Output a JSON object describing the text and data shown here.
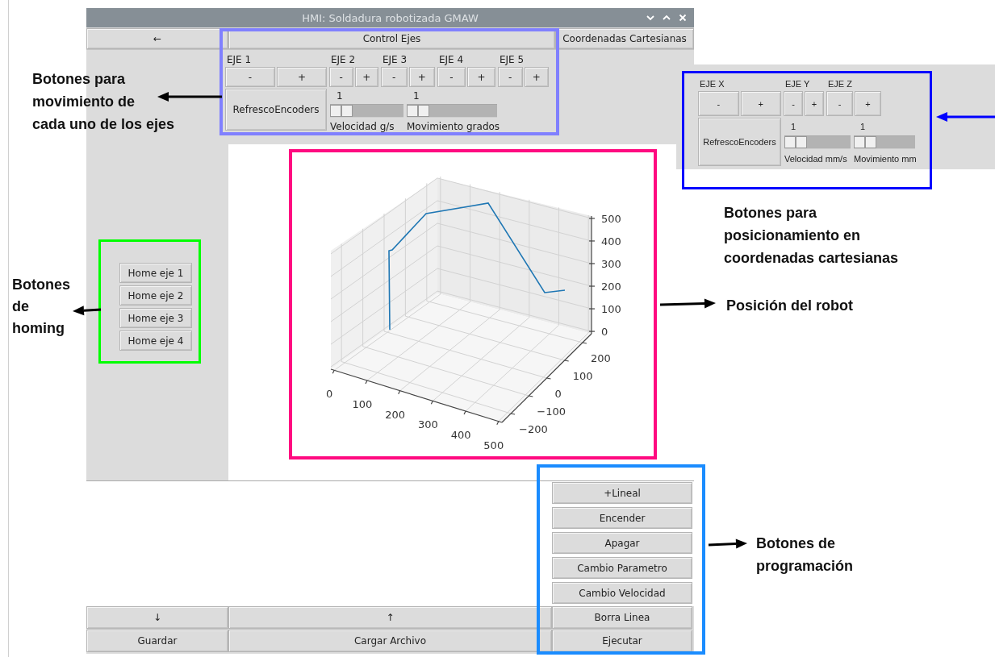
{
  "window": {
    "title": "HMI: Soldadura robotizada GMAW"
  },
  "top_buttons": [
    "←",
    "Control Ejes",
    "Coordenadas Cartesianas"
  ],
  "axis_panel": {
    "axes": [
      {
        "label": "EJE 1",
        "buttons": [
          "-",
          "+"
        ]
      },
      {
        "label": "EJE 2",
        "buttons": [
          "-",
          "+"
        ]
      },
      {
        "label": "EJE 3",
        "buttons": [
          "-",
          "+"
        ]
      },
      {
        "label": "EJE 4",
        "buttons": [
          "-",
          "+"
        ]
      },
      {
        "label": "EJE 5",
        "buttons": [
          "-",
          "+"
        ]
      }
    ],
    "refresh_button": "RefrescoEncoders",
    "sliders": [
      {
        "value": "1",
        "level": 0,
        "caption": "Velocidad g/s"
      },
      {
        "value": "1",
        "level": 0,
        "caption": "Movimiento grados"
      }
    ]
  },
  "homing_buttons": [
    "Home eje 1",
    "Home eje 2",
    "Home eje 3",
    "Home eje 4"
  ],
  "plot": {
    "x_ticks": [
      "0",
      "100",
      "200",
      "300",
      "400",
      "500"
    ],
    "y_ticks": [
      "−200",
      "−100",
      "0",
      "100",
      "200"
    ],
    "z_ticks": [
      "500",
      "400",
      "300",
      "200",
      "100",
      "0"
    ]
  },
  "program_buttons": [
    "+Lineal",
    "Encender",
    "Apagar",
    "Cambio Parametro",
    "Cambio Velocidad"
  ],
  "bottom_rows": [
    [
      "↓",
      "↑",
      "Borra Linea"
    ],
    [
      "Guardar",
      "Cargar Archivo",
      "Ejecutar"
    ]
  ],
  "cartesian_inset": {
    "axes": [
      {
        "label": "EJE X",
        "buttons": [
          "-",
          "+"
        ]
      },
      {
        "label": "EJE Y",
        "buttons": [
          "-",
          "+"
        ]
      },
      {
        "label": "EJE Z",
        "buttons": [
          "-",
          "+"
        ]
      }
    ],
    "refresh_button": "RefrescoEncoders",
    "sliders": [
      {
        "value": "1",
        "level": 0,
        "caption": "Velocidad mm/s"
      },
      {
        "value": "1",
        "level": 0,
        "caption": "Movimiento mm"
      }
    ]
  },
  "annotations": [
    {
      "lines": [
        "Botones para",
        "movimiento de",
        "cada uno de los ejes"
      ],
      "color": "#8080ff"
    },
    {
      "lines": [
        "Botones para",
        "posicionamiento en",
        "coordenadas cartesianas"
      ],
      "color": "#0000ff"
    },
    {
      "lines": [
        "Botones",
        "de",
        "homing"
      ],
      "color": "#00ff00"
    },
    {
      "lines": [
        "Posición del robot"
      ],
      "color": "#ff0a80"
    },
    {
      "lines": [
        "Botones de",
        "programación"
      ],
      "color": "#1a8cff"
    }
  ]
}
